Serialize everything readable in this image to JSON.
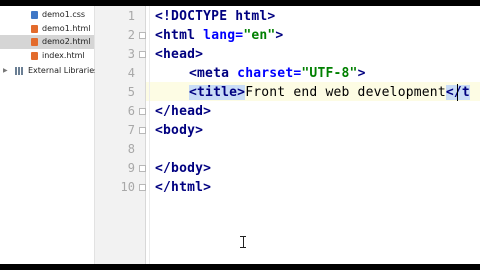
{
  "project_tree": {
    "items": [
      {
        "label": "demo1.css",
        "color": "#3f77c6",
        "selected": false
      },
      {
        "label": "demo1.html",
        "color": "#e36b2c",
        "selected": false
      },
      {
        "label": "demo2.html",
        "color": "#e36b2c",
        "selected": true
      },
      {
        "label": "index.html",
        "color": "#e36b2c",
        "selected": false
      }
    ],
    "external_libraries": {
      "label": "External Libraries",
      "icon": "library-icon",
      "expander": "chevron-right-icon"
    }
  },
  "gutter": {
    "line_numbers": [
      "1",
      "2",
      "3",
      "4",
      "5",
      "6",
      "7",
      "8",
      "9",
      "10"
    ]
  },
  "editor": {
    "current_line": "5",
    "code": {
      "l1": "<!DOCTYPE html>",
      "l2_open": "<html ",
      "l2_attr": "lang=",
      "l2_val": "\"en\"",
      "l2_close": ">",
      "l3": "<head>",
      "l4_open": "<meta ",
      "l4_attr": "charset=",
      "l4_val": "\"UTF-8\"",
      "l4_close": ">",
      "l5_open": "<title>",
      "l5_text": "Front end web development",
      "l5_close": "</t",
      "l6": "</head>",
      "l7": "<body>",
      "l9": "</body>",
      "l10": "</html>"
    },
    "colors": {
      "tag": "#000080",
      "attr": "#0000ff",
      "string": "#008000",
      "highlight": "#c9dcf6",
      "current_line": "#fdfce4"
    }
  }
}
